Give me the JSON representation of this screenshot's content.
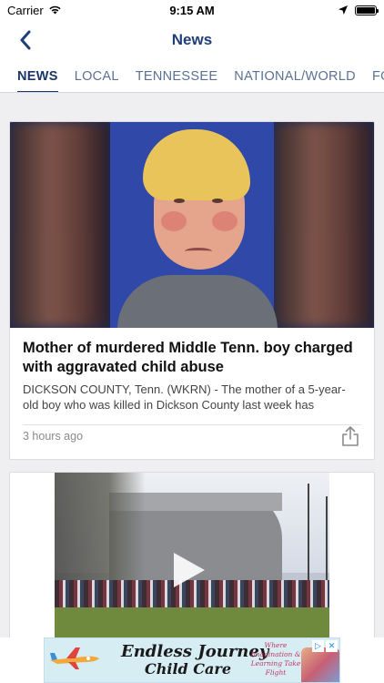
{
  "status_bar": {
    "carrier": "Carrier",
    "time": "9:15 AM",
    "icons": [
      "wifi-icon",
      "location-arrow-icon",
      "battery-icon"
    ]
  },
  "nav": {
    "title": "News",
    "back_icon": "chevron-left-icon",
    "accent_color": "#1f3f78"
  },
  "tabs": [
    {
      "label": "NEWS",
      "active": true
    },
    {
      "label": "LOCAL",
      "active": false
    },
    {
      "label": "TENNESSEE",
      "active": false
    },
    {
      "label": "NATIONAL/WORLD",
      "active": false
    },
    {
      "label": "FOO",
      "active": false
    }
  ],
  "articles": [
    {
      "title": "Mother of murdered Middle Tenn. boy charged with aggravated child abuse",
      "summary": "DICKSON COUNTY, Tenn. (WKRN) - The mother of a 5-year-old boy who was killed in Dickson County last week has",
      "time_ago": "3 hours ago",
      "share_icon": "share-icon"
    },
    {
      "media": "video",
      "play_icon": "play-icon"
    }
  ],
  "ad": {
    "headline": "Endless Journey",
    "subline": "Child Care",
    "tagline": "Where Imagination & Learning Take Flight",
    "controls": [
      "▷",
      "✕"
    ]
  }
}
